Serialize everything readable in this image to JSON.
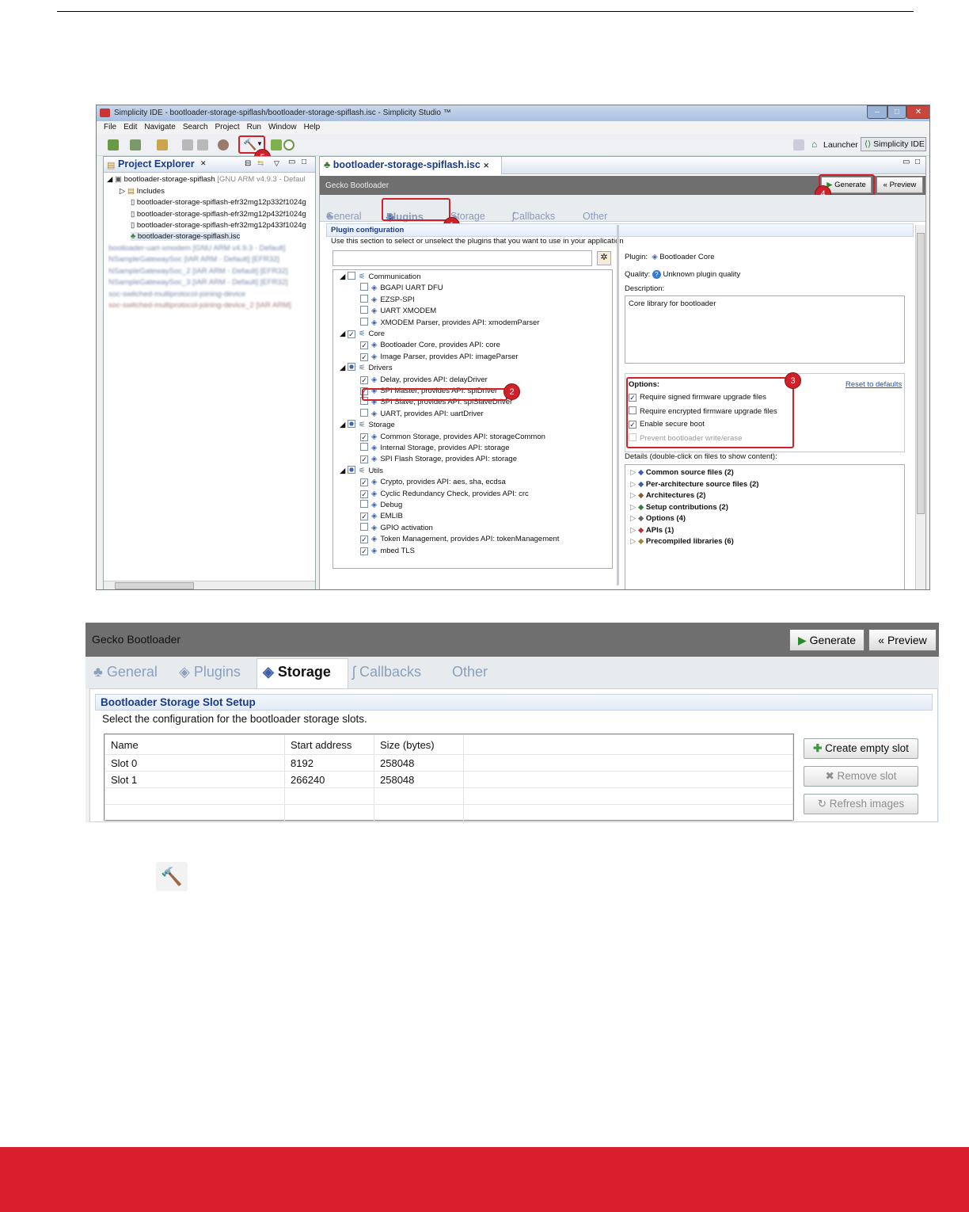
{
  "window1": {
    "title": "Simplicity IDE - bootloader-storage-spiflash/bootloader-storage-spiflash.isc - Simplicity Studio ™",
    "menu": [
      "File",
      "Edit",
      "Navigate",
      "Search",
      "Project",
      "Run",
      "Window",
      "Help"
    ],
    "launcher_label": "Launcher",
    "perspective_label": "Simplicity IDE",
    "project_explorer": {
      "title": "Project Explorer",
      "root": "bootloader-storage-spiflash",
      "root_suffix": "[GNU ARM v4.9.3 - Defaul",
      "items": [
        "Includes",
        "bootloader-storage-spiflash-efr32mg12p332f1024g",
        "bootloader-storage-spiflash-efr32mg12p432f1024g",
        "bootloader-storage-spiflash-efr32mg12p433f1024g",
        "bootloader-storage-spiflash.isc"
      ],
      "blurred": [
        "bootloader-uart-xmodem [GNU ARM v4.9.3 - Default]",
        "NSampleGatewaySoc [IAR ARM - Default] [EFR32]",
        "NSampleGatewaySoc_2 [IAR ARM - Default] [EFR32]",
        "NSampleGatewaySoc_3 [IAR ARM - Default] [EFR32]",
        "soc-switched-multiprotocol-joining-device",
        "soc-switched-multiprotocol-joining-device_2 [IAR ARM]"
      ]
    },
    "editor_tab": "bootloader-storage-spiflash.isc",
    "gecko_title": "Gecko Bootloader",
    "generate_label": "Generate",
    "preview_label": "Preview",
    "tabs": [
      "General",
      "Plugins",
      "Storage",
      "Callbacks",
      "Other"
    ],
    "plugin_config": {
      "title": "Plugin configuration",
      "subtitle": "Use this section to select or unselect the plugins that you want to use in your application"
    },
    "groups": [
      {
        "name": "Communication",
        "items": [
          {
            "label": "BGAPI UART DFU",
            "checked": false
          },
          {
            "label": "EZSP-SPI",
            "checked": false
          },
          {
            "label": "UART XMODEM",
            "checked": false
          },
          {
            "label": "XMODEM Parser, provides API: xmodemParser",
            "checked": false
          }
        ]
      },
      {
        "name": "Core",
        "items": [
          {
            "label": "Bootloader Core, provides API: core",
            "checked": true
          },
          {
            "label": "Image Parser, provides API: imageParser",
            "checked": true
          }
        ]
      },
      {
        "name": "Drivers",
        "items": [
          {
            "label": "Delay, provides API: delayDriver",
            "checked": true
          },
          {
            "label": "SPI Master, provides API: spiDriver",
            "checked": true
          },
          {
            "label": "SPI Slave, provides API: spiSlaveDriver",
            "checked": false
          },
          {
            "label": "UART, provides API: uartDriver",
            "checked": false
          }
        ]
      },
      {
        "name": "Storage",
        "items": [
          {
            "label": "Common Storage, provides API: storageCommon",
            "checked": true
          },
          {
            "label": "Internal Storage, provides API: storage",
            "checked": false
          },
          {
            "label": "SPI Flash Storage, provides API: storage",
            "checked": true
          }
        ]
      },
      {
        "name": "Utils",
        "items": [
          {
            "label": "Crypto, provides API: aes, sha, ecdsa",
            "checked": true
          },
          {
            "label": "Cyclic Redundancy Check, provides API: crc",
            "checked": true
          },
          {
            "label": "Debug",
            "checked": false
          },
          {
            "label": "EMLIB",
            "checked": true
          },
          {
            "label": "GPIO activation",
            "checked": false
          },
          {
            "label": "Token Management, provides API: tokenManagement",
            "checked": true
          },
          {
            "label": "mbed TLS",
            "checked": true
          }
        ]
      }
    ],
    "details": {
      "plugin_label": "Plugin:",
      "plugin_value": "Bootloader Core",
      "quality_label": "Quality:",
      "quality_value": "Unknown plugin quality",
      "description_label": "Description:",
      "description_value": "Core library for bootloader",
      "options_label": "Options:",
      "reset_label": "Reset to defaults",
      "options": [
        {
          "label": "Require signed firmware upgrade files",
          "checked": true
        },
        {
          "label": "Require encrypted firmware upgrade files",
          "checked": false
        },
        {
          "label": "Enable secure boot",
          "checked": true
        },
        {
          "label": "Prevent bootloader write/erase",
          "checked": false,
          "disabled": true
        }
      ],
      "files_label": "Details (double-click on files to show content):",
      "files": [
        "Common source files (2)",
        "Per-architecture source files (2)",
        "Architectures (2)",
        "Setup contributions (2)",
        "Options (4)",
        "APIs (1)",
        "Precompiled libraries (6)"
      ]
    },
    "callouts": [
      "1",
      "2",
      "3",
      "4",
      "5"
    ]
  },
  "window2": {
    "gecko_title": "Gecko Bootloader",
    "generate_label": "Generate",
    "preview_label": "Preview",
    "tabs": [
      "General",
      "Plugins",
      "Storage",
      "Callbacks",
      "Other"
    ],
    "section_title": "Bootloader Storage Slot Setup",
    "section_subtitle": "Select the configuration for the bootloader storage slots.",
    "columns": [
      "Name",
      "Start address",
      "Size (bytes)"
    ],
    "rows": [
      [
        "Slot 0",
        "8192",
        "258048"
      ],
      [
        "Slot 1",
        "266240",
        "258048"
      ]
    ],
    "buttons": {
      "create": "Create empty slot",
      "remove": "Remove slot",
      "refresh": "Refresh images"
    }
  },
  "colors": {
    "footer": "#d81e2c",
    "callout": "#d0202a",
    "header_gray": "#6f6f6f"
  }
}
